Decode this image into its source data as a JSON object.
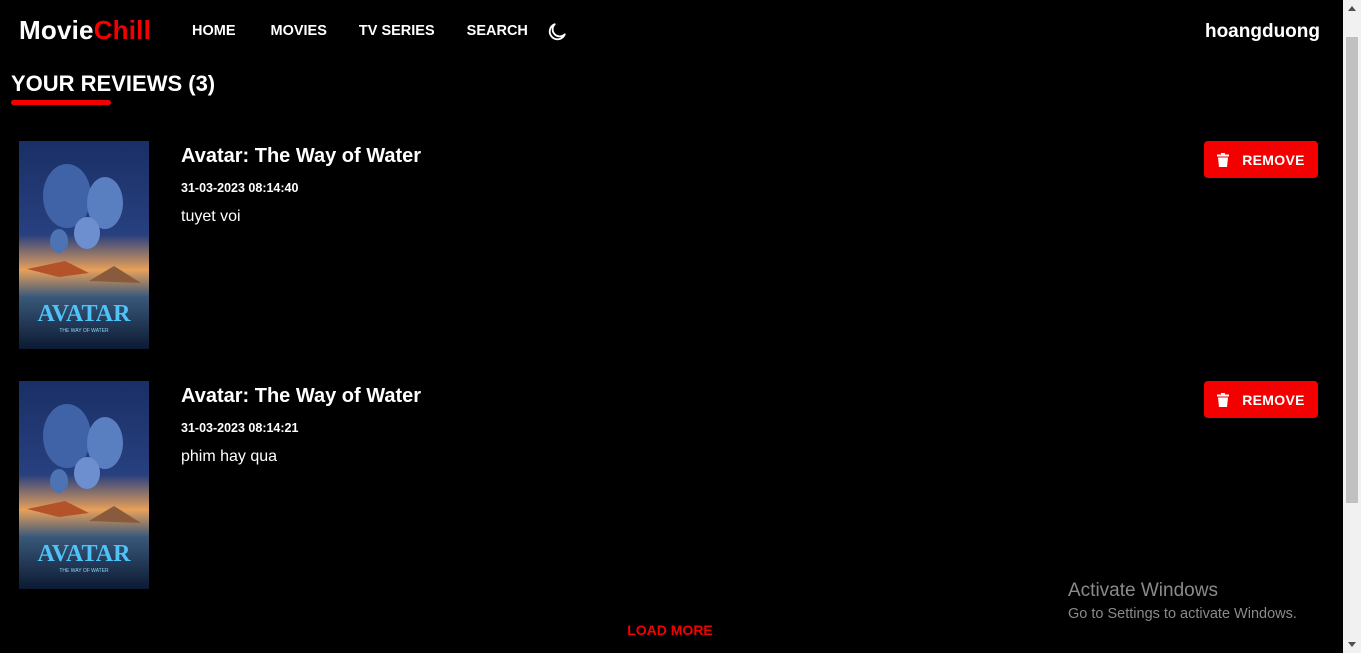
{
  "header": {
    "logo_part1": "Movie",
    "logo_part2": "Chill",
    "nav": [
      "HOME",
      "MOVIES",
      "TV SERIES",
      "SEARCH"
    ],
    "theme_icon": "moon-icon",
    "username": "hoangduong"
  },
  "page": {
    "title": "YOUR REVIEWS (3)"
  },
  "reviews": [
    {
      "movie_title": "Avatar: The Way of Water",
      "date": "31-03-2023 08:14:40",
      "content": "tuyet voi",
      "remove_label": "REMOVE",
      "poster_title": "AVATAR",
      "poster_subtitle": "THE WAY OF WATER"
    },
    {
      "movie_title": "Avatar: The Way of Water",
      "date": "31-03-2023 08:14:21",
      "content": "phim hay qua",
      "remove_label": "REMOVE",
      "poster_title": "AVATAR",
      "poster_subtitle": "THE WAY OF WATER"
    }
  ],
  "load_more": "LOAD MORE",
  "watermark": {
    "line1": "Activate Windows",
    "line2": "Go to Settings to activate Windows."
  },
  "colors": {
    "accent": "#f50000",
    "background": "#000000",
    "text": "#ffffff"
  }
}
